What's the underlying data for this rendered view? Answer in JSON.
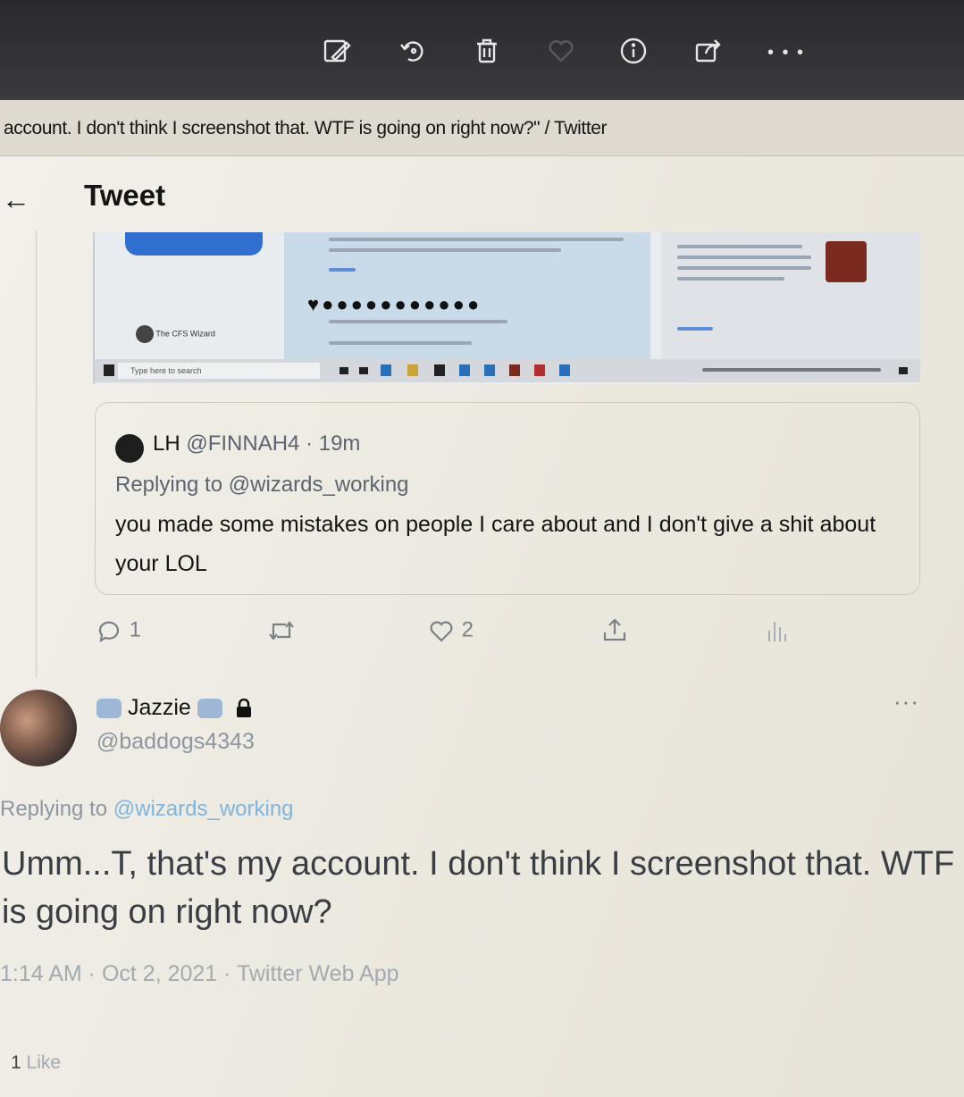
{
  "window": {
    "title": "account. I don't think I screenshot that. WTF is going on right now?\" / Twitter",
    "toolbar_icons": [
      "edit-image-icon",
      "rotate-icon",
      "trash-icon",
      "heart-icon",
      "info-icon",
      "share-icon",
      "more-icon"
    ],
    "toolbar_more": "• • •"
  },
  "header": {
    "back": "←",
    "title": "Tweet"
  },
  "embedded_screenshot": {
    "account_name": "The CFS Wizard",
    "search_placeholder": "Type here to search",
    "emoji_row": "♥●●●●●●●●●●●"
  },
  "quoted_tweet": {
    "name": "LH",
    "handle": "@FINNAH4",
    "separator": " · ",
    "time": "19m",
    "replying_to_label": "Replying to ",
    "replying_to_handle": "@wizards_working",
    "text": "you made some mistakes on people I care about and I don't give a shit about your LOL"
  },
  "actions": {
    "reply_count": "1",
    "like_count": "2"
  },
  "reply_tweet": {
    "name": "Jazzie",
    "handle": "@baddogs4343",
    "more": "···",
    "replying_to_label": "Replying to ",
    "replying_to_handle": "@wizards_working",
    "text": "Umm...T, that's my account. I don't think I screenshot that. WTF is going on right now?",
    "time": "1:14 AM",
    "date": "Oct 2, 2021",
    "source": "Twitter Web App",
    "meta_sep": " · ",
    "likes_count": "1",
    "likes_label": " Like"
  },
  "colors": {
    "link": "#7fb5dc",
    "topbar": "#2f2f31",
    "screenshot_button": "#2f6fd0"
  }
}
